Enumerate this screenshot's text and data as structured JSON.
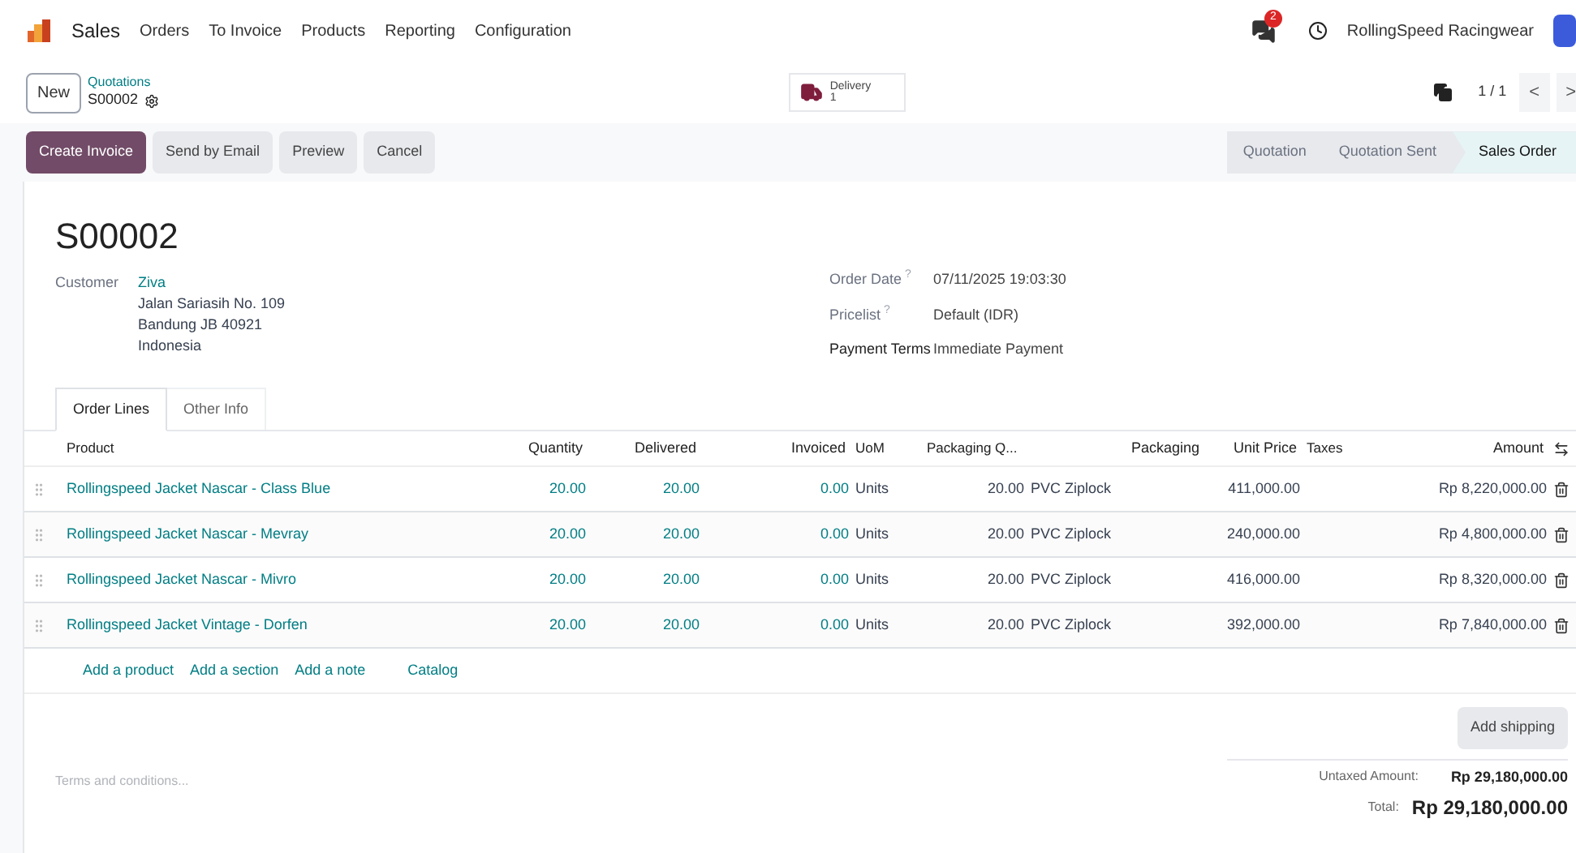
{
  "navbar": {
    "app": "Sales",
    "menu": [
      "Orders",
      "To Invoice",
      "Products",
      "Reporting",
      "Configuration"
    ],
    "chat_count": "2",
    "company": "RollingSpeed Racingwear"
  },
  "control_panel": {
    "new_button": "New",
    "breadcrumb": "Quotations",
    "record": "S00002",
    "smart_button": {
      "label": "Delivery",
      "count": "1"
    },
    "pager": "1 / 1",
    "prev": "<",
    "next": ">"
  },
  "actions": [
    {
      "label": "Create Invoice",
      "primary": true
    },
    {
      "label": "Send by Email",
      "primary": false
    },
    {
      "label": "Preview",
      "primary": false
    },
    {
      "label": "Cancel",
      "primary": false
    }
  ],
  "stages": [
    {
      "label": "Quotation",
      "selected": false
    },
    {
      "label": "Quotation Sent",
      "selected": false
    },
    {
      "label": "Sales Order",
      "selected": true
    }
  ],
  "form": {
    "title": "S00002",
    "customer": {
      "label": "Customer",
      "name": "Ziva",
      "address": [
        "Jalan Sariasih No. 109",
        "Bandung JB 40921",
        "Indonesia"
      ]
    },
    "fields": [
      {
        "label": "Order Date",
        "help": "?",
        "value": "07/11/2025 19:03:30"
      },
      {
        "label": "Pricelist",
        "help": "?",
        "value": "Default (IDR)"
      },
      {
        "label": "Payment Terms",
        "value": "Immediate Payment"
      }
    ]
  },
  "tabs": [
    {
      "label": "Order Lines",
      "selected": true
    },
    {
      "label": "Other Info",
      "selected": false
    }
  ],
  "table": {
    "columns": [
      "Product",
      "Quantity",
      "Delivered",
      "Invoiced",
      "UoM",
      "Packaging Q...",
      "Packaging",
      "Unit Price",
      "Taxes",
      "Amount"
    ],
    "rows": [
      {
        "product": "Rollingspeed Jacket Nascar - Class Blue",
        "quantity": "20.00",
        "delivered": "20.00",
        "invoiced": "0.00",
        "uom": "Units",
        "packaging_qty": "20.00",
        "packaging": "PVC Ziplock",
        "unit_price": "411,000.00",
        "amount": "Rp 8,220,000.00"
      },
      {
        "product": "Rollingspeed Jacket Nascar - Mevray",
        "quantity": "20.00",
        "delivered": "20.00",
        "invoiced": "0.00",
        "uom": "Units",
        "packaging_qty": "20.00",
        "packaging": "PVC Ziplock",
        "unit_price": "240,000.00",
        "amount": "Rp 4,800,000.00"
      },
      {
        "product": "Rollingspeed Jacket Nascar - Mivro",
        "quantity": "20.00",
        "delivered": "20.00",
        "invoiced": "0.00",
        "uom": "Units",
        "packaging_qty": "20.00",
        "packaging": "PVC Ziplock",
        "unit_price": "416,000.00",
        "amount": "Rp 8,320,000.00"
      },
      {
        "product": "Rollingspeed Jacket Vintage - Dorfen",
        "quantity": "20.00",
        "delivered": "20.00",
        "invoiced": "0.00",
        "uom": "Units",
        "packaging_qty": "20.00",
        "packaging": "PVC Ziplock",
        "unit_price": "392,000.00",
        "amount": "Rp 7,840,000.00"
      }
    ],
    "add_links": [
      "Add a product",
      "Add a section",
      "Add a note",
      "Catalog"
    ]
  },
  "footer": {
    "terms_placeholder": "Terms and conditions...",
    "add_shipping": "Add shipping",
    "untaxed_label": "Untaxed Amount:",
    "untaxed_value": "Rp 29,180,000.00",
    "total_label": "Total:",
    "total_value": "Rp 29,180,000.00"
  }
}
